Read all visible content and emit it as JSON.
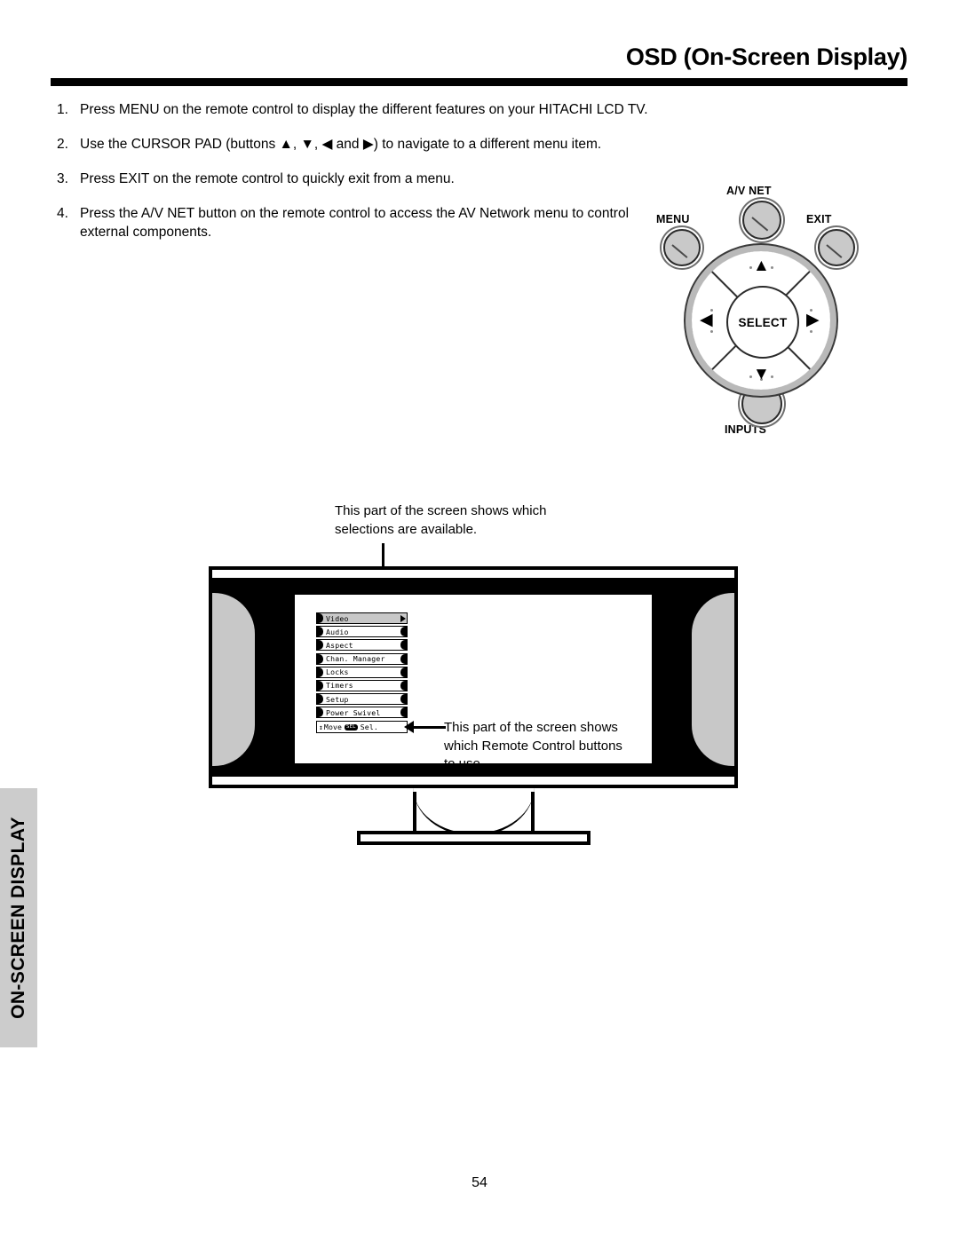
{
  "header": {
    "title": "OSD (On-Screen Display)"
  },
  "instructions": [
    {
      "num": "1.",
      "text": "Press MENU on the remote control to display the different features on your HITACHI LCD TV."
    },
    {
      "num": "2.",
      "text": "Use the CURSOR PAD (buttons ▲, ▼, ◀ and ▶) to navigate to a different menu item."
    },
    {
      "num": "3.",
      "text": "Press EXIT on the remote control to quickly exit from a menu."
    },
    {
      "num": "4.",
      "text": "Press the A/V NET button on the remote control to access the AV Network menu to control external components."
    }
  ],
  "remote": {
    "avnet_label": "A/V NET",
    "menu_label": "MENU",
    "exit_label": "EXIT",
    "inputs_label": "INPUTS",
    "select_label": "SELECT",
    "arrow_up": "▲",
    "arrow_down": "▼",
    "arrow_left": "◀",
    "arrow_right": "▶"
  },
  "callouts": {
    "top": "This part of the screen shows which selections are available.",
    "right": "This part of the screen shows which Remote Control buttons to use."
  },
  "osd": {
    "items": [
      {
        "label": "Video",
        "selected": true
      },
      {
        "label": "Audio",
        "selected": false
      },
      {
        "label": "Aspect",
        "selected": false
      },
      {
        "label": "Chan. Manager",
        "selected": false
      },
      {
        "label": "Locks",
        "selected": false
      },
      {
        "label": "Timers",
        "selected": false
      },
      {
        "label": "Setup",
        "selected": false
      },
      {
        "label": "Power Swivel",
        "selected": false
      }
    ],
    "hint": {
      "arrows": "↕",
      "move_label": "Move",
      "select_key": "SEL",
      "select_label": "Sel."
    }
  },
  "side_tab": {
    "label": "ON-SCREEN DISPLAY"
  },
  "footer": {
    "page_number": "54"
  },
  "colors": {
    "gray_fill": "#c8c8c8",
    "tab_gray": "#cccccc",
    "black": "#000000"
  }
}
